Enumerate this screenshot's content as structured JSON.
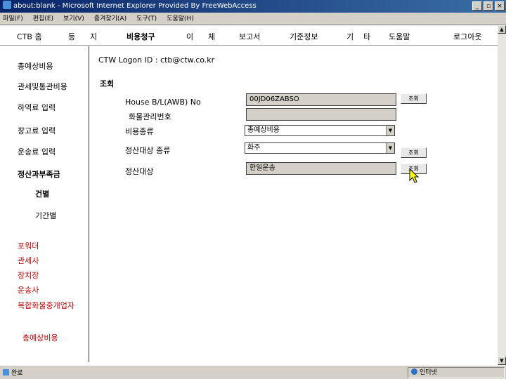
{
  "window": {
    "title": "about:blank - Microsoft Internet Explorer Provided By FreeWebAccess",
    "menu": [
      "파일(F)",
      "편집(E)",
      "보기(V)",
      "즐겨찾기(A)",
      "도구(T)",
      "도움말(H)"
    ]
  },
  "nav": {
    "items": [
      "CTB 홈",
      "등",
      "지",
      "비용청구",
      "이",
      "체",
      "보고서",
      "기준정보",
      "기",
      "타",
      "도움말",
      "로그아웃"
    ]
  },
  "sidebar": {
    "items": [
      "총예상비용",
      "관세및통관비용",
      "하역료 입력",
      "창고료 입력",
      "운송료 입력",
      "정산과부족금",
      "건별",
      "기간별"
    ],
    "links": [
      "포워더",
      "관세사",
      "장치장",
      "운송사",
      "복합화물중개업자"
    ],
    "footer": "총예상비용"
  },
  "main": {
    "logon_label": "CTW Logon ID : ctb@ctw.co.kr",
    "section_title": "조회",
    "fields": {
      "house_bl_label": "House B/L(AWB) No",
      "house_bl_value": "00JD06ZABSO",
      "cargo_no_label": "화물관리번호",
      "cargo_no_value": "",
      "cost_type_label": "비용종류",
      "cost_type_value": "총예상비용",
      "settle_type_label": "정산대상 종류",
      "settle_type_value": "화주",
      "settle_target_label": "정산대상",
      "settle_target_value": "한일운송"
    },
    "buttons": {
      "query1": "조회",
      "query2": "조회",
      "query3": "조회"
    }
  },
  "status": {
    "left": "완료",
    "zone": "인터넷"
  },
  "colors": {
    "titlebar": "#0a246a",
    "link_red": "#c00000",
    "chrome": "#d4d0c8"
  }
}
